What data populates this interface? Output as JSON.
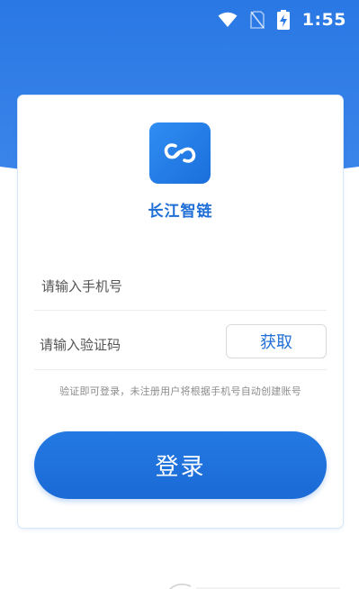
{
  "status_bar": {
    "time": "1:55",
    "icons": [
      "wifi-icon",
      "no-sim-icon",
      "battery-charging-icon"
    ]
  },
  "brand": {
    "name": "长江智链",
    "logo_icon": "link-logo-icon"
  },
  "form": {
    "phone_placeholder": "请输入手机号",
    "phone_value": "",
    "code_placeholder": "请输入验证码",
    "code_value": "",
    "get_code_label": "获取",
    "hint": "验证即可登录，未注册用户将根据手机号自动创建账号",
    "login_label": "登录"
  },
  "colors": {
    "primary": "#1f6fd6",
    "header_bg": "#2a78e4",
    "hint_text": "#8c8c8c"
  }
}
